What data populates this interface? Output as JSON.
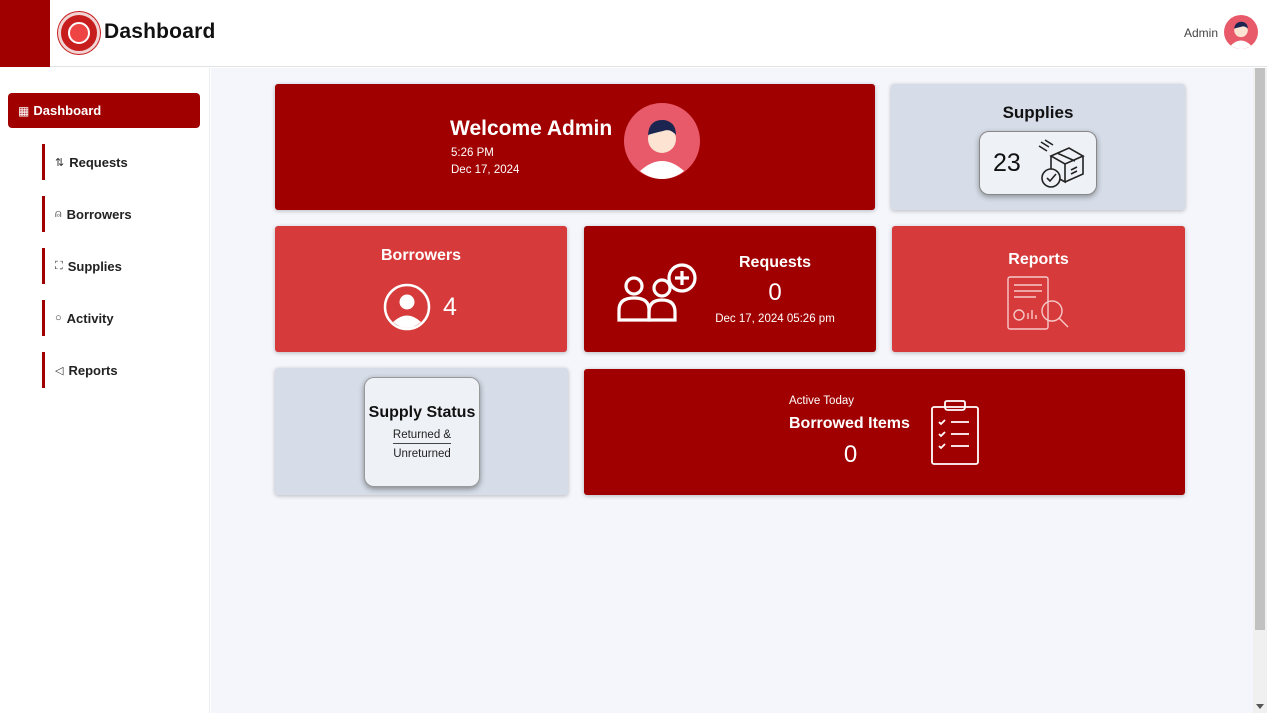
{
  "header": {
    "title": "Dashboard",
    "user_name": "Admin",
    "logo_icon": "university-seal-icon",
    "avatar_icon": "user-avatar-icon"
  },
  "sidebar": {
    "items": [
      {
        "label": "Dashboard",
        "icon": "grid-icon",
        "glyph": "▦",
        "active": true
      },
      {
        "label": "Requests",
        "icon": "git-pull-icon",
        "glyph": "⇅",
        "active": false
      },
      {
        "label": "Borrowers",
        "icon": "person-icon",
        "glyph": "⍝",
        "active": false
      },
      {
        "label": "Supplies",
        "icon": "basket-icon",
        "glyph": "⛶",
        "active": false
      },
      {
        "label": "Activity",
        "icon": "circle-icon",
        "glyph": "○",
        "active": false
      },
      {
        "label": "Reports",
        "icon": "megaphone-icon",
        "glyph": "◁",
        "active": false
      }
    ]
  },
  "welcome": {
    "title": "Welcome Admin",
    "time": "5:26 PM",
    "date": "Dec 17, 2024"
  },
  "supplies": {
    "title": "Supplies",
    "count": "23"
  },
  "borrowers": {
    "title": "Borrowers",
    "count": "4"
  },
  "requests": {
    "title": "Requests",
    "count": "0",
    "datetime": "Dec 17, 2024 05:26 pm"
  },
  "reports": {
    "title": "Reports"
  },
  "supply_status": {
    "title": "Supply Status",
    "line1": "Returned &",
    "line2": "Unreturned"
  },
  "borrowed_items": {
    "subtitle": "Active Today",
    "title": "Borrowed Items",
    "count": "0"
  },
  "colors": {
    "primary": "#a10000",
    "secondary": "#d63a3a",
    "card_grey": "#d6dde8",
    "main_bg": "#f4f6fb"
  }
}
